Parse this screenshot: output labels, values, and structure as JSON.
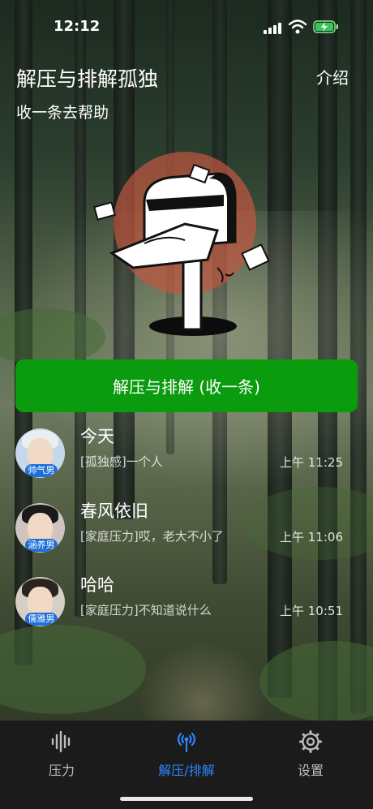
{
  "status": {
    "time": "12:12"
  },
  "header": {
    "title": "解压与排解孤独",
    "intro_label": "介绍",
    "subtitle": "收一条去帮助"
  },
  "action": {
    "label": "解压与排解 (收一条)"
  },
  "messages": [
    {
      "name": "今天",
      "badge": "帅气男",
      "preview": "[孤独感]一个人",
      "time": "上午 11:25"
    },
    {
      "name": "春风依旧",
      "badge": "涵养男",
      "preview": "[家庭压力]哎，老大不小了",
      "time": "上午 11:06"
    },
    {
      "name": "哈哈",
      "badge": "儒雅男",
      "preview": "[家庭压力]不知道说什么",
      "time": "上午 10:51"
    }
  ],
  "tabs": [
    {
      "label": "压力",
      "icon": "waveform-icon"
    },
    {
      "label": "解压/排解",
      "icon": "antenna-icon"
    },
    {
      "label": "设置",
      "icon": "gear-icon"
    }
  ],
  "colors": {
    "accent_green": "#0a9b0f",
    "active_tab": "#2c86ff",
    "badge_blue": "#1f6fd8"
  }
}
